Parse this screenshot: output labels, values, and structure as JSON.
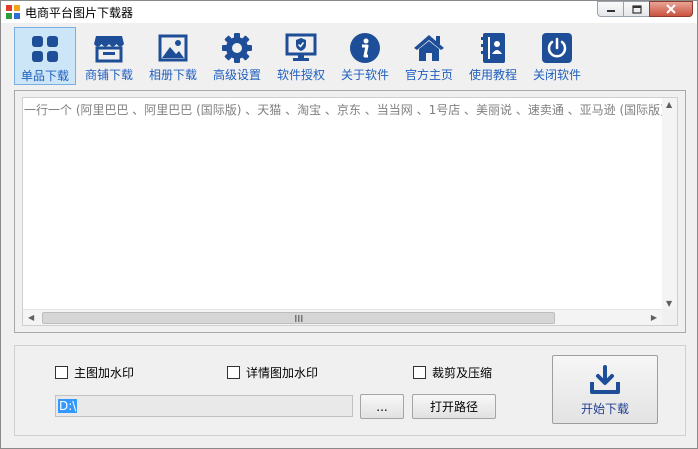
{
  "window": {
    "title": "电商平台图片下载器",
    "accent": "#1f4e99",
    "label_color": "#1f5fbf"
  },
  "toolbar": {
    "items": [
      {
        "label": "单品下载",
        "icon": "grid-icon",
        "active": true
      },
      {
        "label": "商铺下载",
        "icon": "store-icon",
        "active": false
      },
      {
        "label": "相册下载",
        "icon": "picture-icon",
        "active": false
      },
      {
        "label": "高级设置",
        "icon": "gear-icon",
        "active": false
      },
      {
        "label": "软件授权",
        "icon": "monitor-shield-icon",
        "active": false
      },
      {
        "label": "关于软件",
        "icon": "info-icon",
        "active": false
      },
      {
        "label": "官方主页",
        "icon": "home-icon",
        "active": false
      },
      {
        "label": "使用教程",
        "icon": "book-icon",
        "active": false
      },
      {
        "label": "关闭软件",
        "icon": "power-icon",
        "active": false
      }
    ]
  },
  "editor": {
    "placeholder": "一行一个 (阿里巴巴 、阿里巴巴 (国际版) 、天猫 、淘宝 、京东 、当当网 、1号店 、美丽说 、速卖通 、亚马逊 (国际版) 、Eb"
  },
  "options": {
    "main_watermark": "主图加水印",
    "detail_watermark": "详情图加水印",
    "crop_compress": "裁剪及压缩",
    "path_value": "D:\\",
    "browse_label": "...",
    "open_path_label": "打开路径",
    "start_label": "开始下载"
  }
}
